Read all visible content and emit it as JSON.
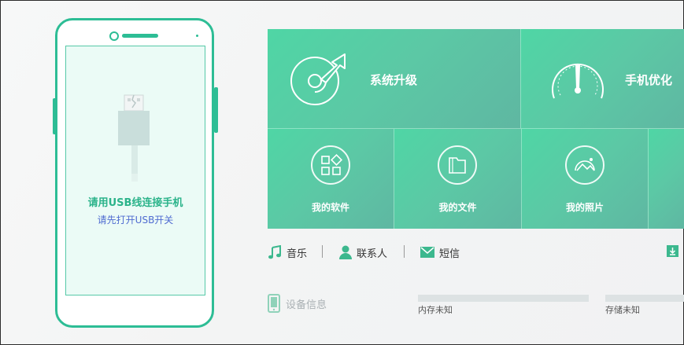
{
  "phone": {
    "connect_title": "请用USB线连接手机",
    "connect_sub": "请先打开USB开关"
  },
  "tiles": {
    "system_upgrade": "系统升级",
    "phone_optimize": "手机优化",
    "my_software": "我的软件",
    "my_files": "我的文件",
    "my_photos": "我的照片"
  },
  "quick_links": {
    "music": "音乐",
    "contacts": "联系人",
    "sms": "短信"
  },
  "device": {
    "title": "设备信息",
    "memory_label": "内存未知",
    "storage_label": "存储未知"
  },
  "colors": {
    "accent": "#2dbd95",
    "tile_start": "#4fd6a5",
    "tile_end": "#5fb7a2",
    "link_blue": "#4f6bd1"
  }
}
